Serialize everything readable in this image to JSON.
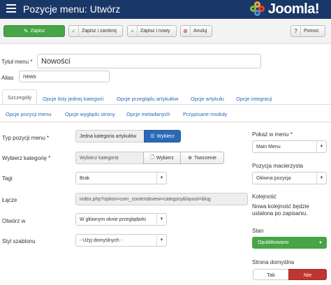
{
  "header": {
    "title": "Pozycje menu: Utwórz",
    "logo_text": "Joomla!"
  },
  "toolbar": {
    "save": "Zapisz",
    "save_close": "Zapisz i zamknij",
    "save_new": "Zapisz i nowy",
    "cancel": "Anuluj",
    "help": "Pomoc"
  },
  "form": {
    "title_label": "Tytuł menu *",
    "title_value": "Nowości",
    "alias_label": "Alias",
    "alias_value": "news"
  },
  "tabs": {
    "row1": [
      "Szczegóły",
      "Opcje listy jednej kategorii",
      "Opcje przeglądu artykułów",
      "Opcje artykułu",
      "Opcje integracji"
    ],
    "row2": [
      "Opcje pozycji menu",
      "Opcje wyglądu strony",
      "Opcje metadanych",
      "Przypisane moduły"
    ]
  },
  "details": {
    "type_label": "Typ pozycji menu *",
    "type_value": "Jedna kategoria artykułów",
    "type_button": "Wybierz",
    "category_label": "Wybierz kategorię *",
    "category_placeholder": "Wybierz kategorię",
    "category_select": "Wybierz",
    "category_create": "Tworzenie",
    "tags_label": "Tagi",
    "tags_value": "Brak",
    "link_label": "Łącze",
    "link_value": "index.php?option=com_content&view=category&layout=blog",
    "target_label": "Otwórz w",
    "target_value": "W głównym oknie przeglądarki",
    "style_label": "Styl szablonu",
    "style_value": "- Użyj domyślnych -"
  },
  "sidebar": {
    "menu_label": "Pokaż w menu *",
    "menu_value": "Main Menu",
    "parent_label": "Pozycja macierzysta",
    "parent_value": "Główna pozycja",
    "order_label": "Kolejność",
    "order_note": "Nowa kolejność będzie ustalona po zapisaniu.",
    "status_label": "Stan",
    "status_value": "Opublikowano",
    "default_label": "Strona domyślna",
    "yes": "Tak",
    "no": "Nie"
  },
  "colors": {
    "header": "#1a3867",
    "save": "#46a546",
    "primary": "#2a69b8",
    "danger": "#bd362f"
  }
}
